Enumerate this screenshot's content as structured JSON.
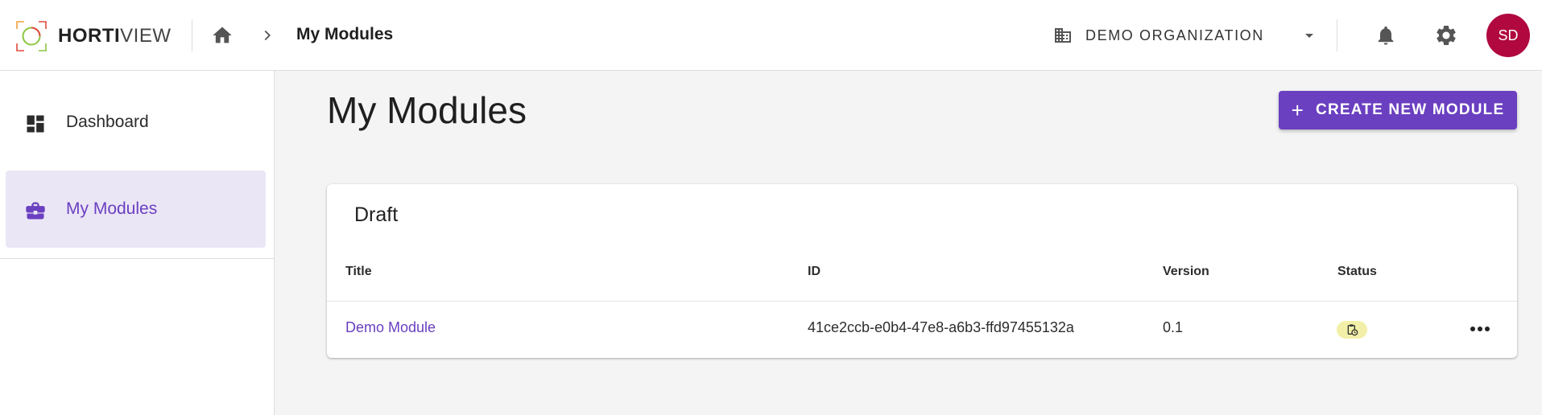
{
  "app": {
    "brand_bold": "HORTI",
    "brand_light": "VIEW"
  },
  "header": {
    "breadcrumb_current": "My Modules",
    "organization": "DEMO ORGANIZATION",
    "avatar_initials": "SD"
  },
  "sidebar": {
    "items": [
      {
        "label": "Dashboard",
        "icon": "dashboard-icon",
        "active": false
      },
      {
        "label": "My Modules",
        "icon": "briefcase-icon",
        "active": true
      }
    ]
  },
  "main": {
    "title": "My Modules",
    "create_button_label": "CREATE NEW MODULE",
    "section": {
      "title": "Draft",
      "columns": [
        "Title",
        "ID",
        "Version",
        "Status"
      ],
      "rows": [
        {
          "title": "Demo Module",
          "id": "41ce2ccb-e0b4-47e8-a6b3-ffd97455132a",
          "version": "0.1",
          "status_icon": "clipboard-clock-icon"
        }
      ]
    }
  },
  "colors": {
    "accent": "#6a3fc0",
    "avatar": "#b0083f",
    "active_nav_bg": "#ebe6f5",
    "status_badge_bg": "#f2f0a8"
  }
}
